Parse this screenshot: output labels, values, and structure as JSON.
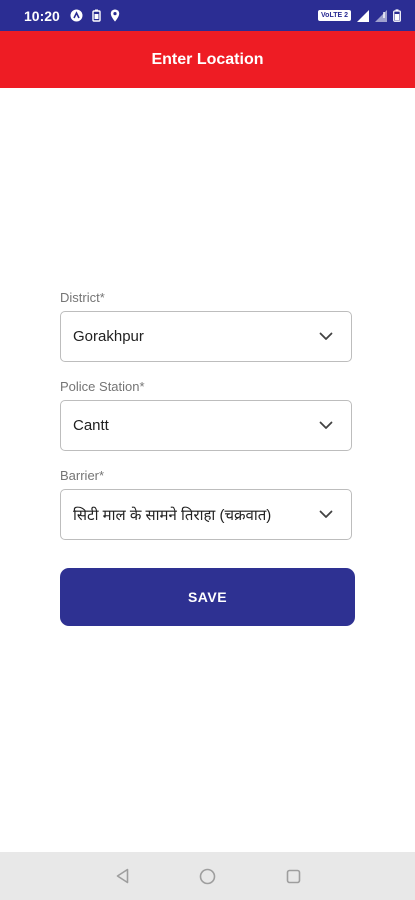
{
  "status_bar": {
    "time": "10:20",
    "volte": "VoLTE 2",
    "icons": [
      "nfc-icon",
      "battery-saver-icon",
      "location-icon",
      "signal-icon",
      "signal-no-data-icon",
      "battery-icon"
    ]
  },
  "app_bar": {
    "title": "Enter Location"
  },
  "form": {
    "district": {
      "label": "District*",
      "value": "Gorakhpur"
    },
    "police_station": {
      "label": "Police Station*",
      "value": "Cantt"
    },
    "barrier": {
      "label": "Barrier*",
      "value": "सिटी माल के सामने तिराहा (चक्रवात)"
    },
    "save_label": "SAVE"
  },
  "nav_bar": {
    "buttons": [
      "back-icon",
      "home-icon",
      "recents-icon"
    ]
  },
  "colors": {
    "status_bar": "#2b2d93",
    "app_bar": "#ee1c24",
    "save_button": "#2e3192",
    "nav_bar": "#e8e8e8"
  }
}
